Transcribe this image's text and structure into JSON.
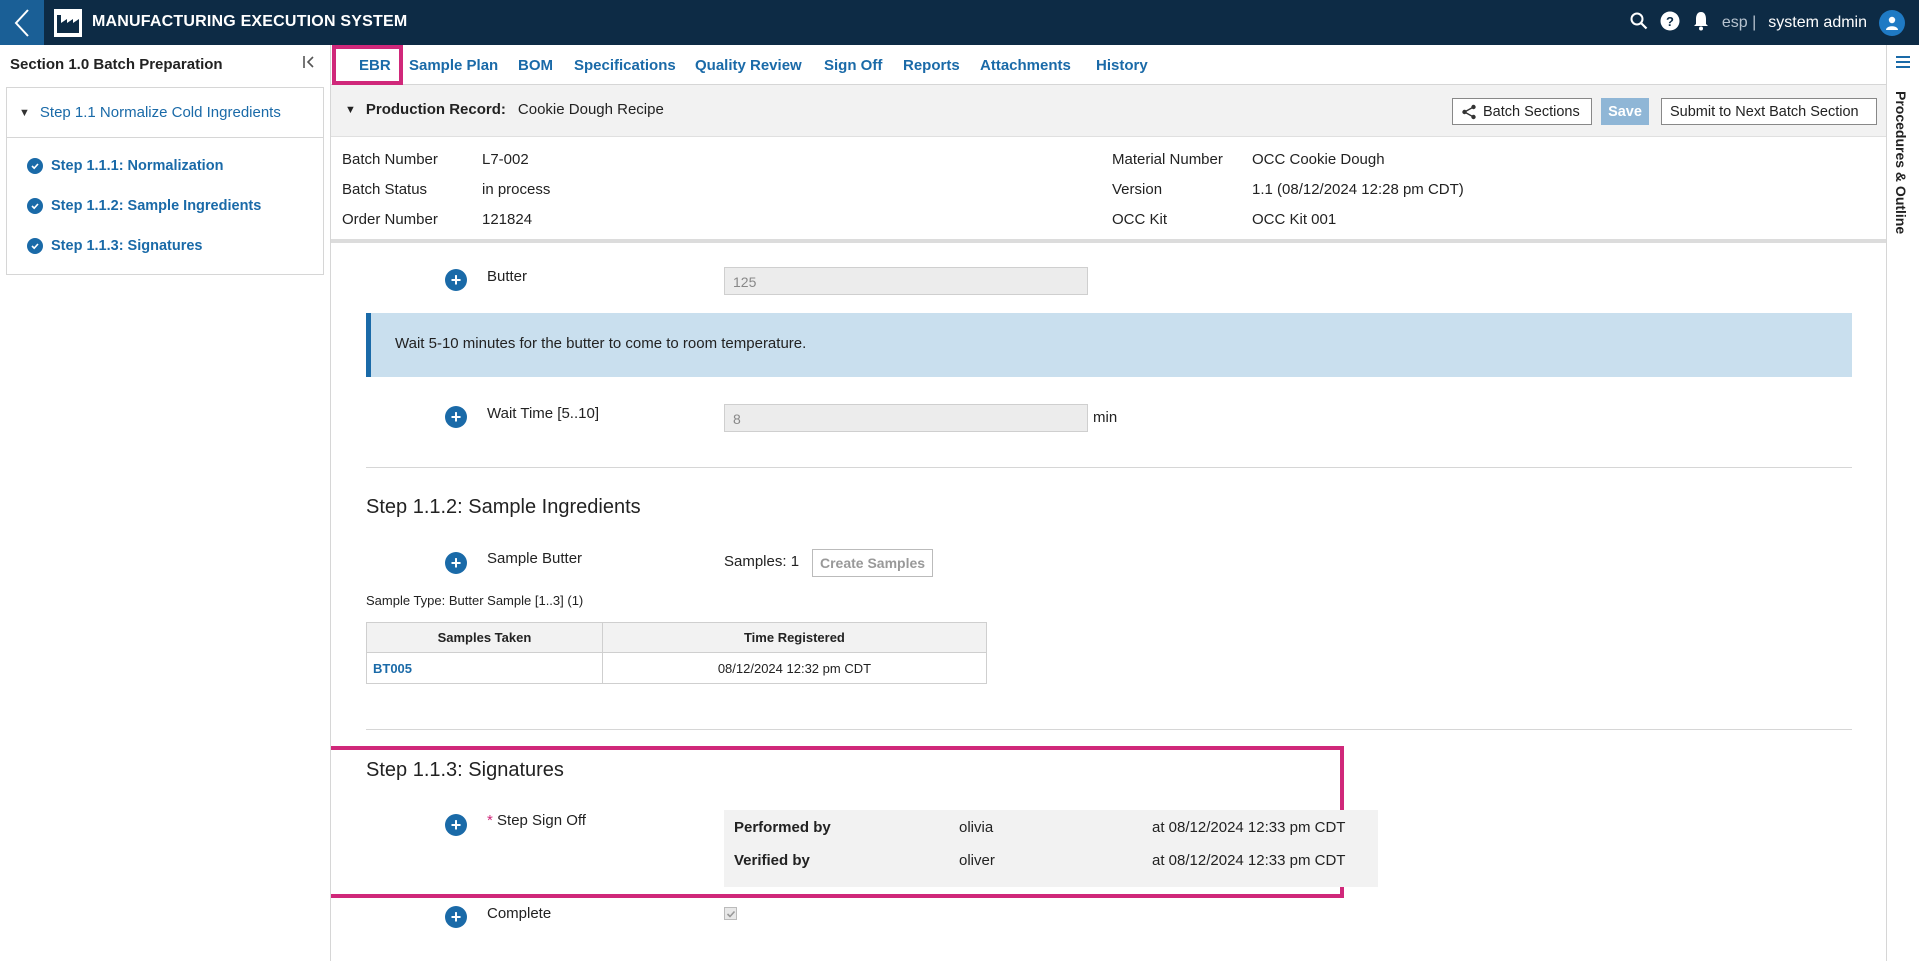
{
  "app": {
    "title": "MANUFACTURING EXECUTION SYSTEM",
    "language": "esp |",
    "user": "system admin"
  },
  "left_panel": {
    "title": "Section 1.0 Batch Preparation",
    "parent_step": "Step 1.1 Normalize Cold Ingredients",
    "steps": [
      "Step 1.1.1: Normalization",
      "Step 1.1.2: Sample Ingredients",
      "Step 1.1.3: Signatures"
    ]
  },
  "tabs": [
    "EBR",
    "Sample Plan",
    "BOM",
    "Specifications",
    "Quality Review",
    "Sign Off",
    "Reports",
    "Attachments",
    "History"
  ],
  "right_rail": {
    "label": "Procedures & Outline"
  },
  "production": {
    "label": "Production Record:",
    "name": "Cookie Dough Recipe",
    "buttons": {
      "batch_sections": "Batch Sections",
      "save": "Save",
      "submit": "Submit to Next Batch Section"
    }
  },
  "info": {
    "batch_number_label": "Batch Number",
    "batch_number": "L7-002",
    "batch_status_label": "Batch Status",
    "batch_status": "in process",
    "order_number_label": "Order Number",
    "order_number": "121824",
    "material_number_label": "Material Number",
    "material_number": "OCC Cookie Dough",
    "version_label": "Version",
    "version": "1.1 (08/12/2024 12:28 pm CDT)",
    "kit_label": "OCC Kit",
    "kit": "OCC Kit 001"
  },
  "fields": {
    "butter_label": "Butter",
    "butter_value": "125",
    "note": "Wait 5-10 minutes for the butter to come to room temperature.",
    "wait_label": "Wait Time [5..10]",
    "wait_value": "8",
    "wait_unit": "min"
  },
  "sample_step": {
    "title": "Step 1.1.2: Sample Ingredients",
    "field_label": "Sample Butter",
    "samples_text": "Samples: 1",
    "create_button": "Create Samples",
    "sample_type": "Sample Type: Butter Sample [1..3] (1)",
    "table": {
      "headers": [
        "Samples Taken",
        "Time Registered"
      ],
      "rows": [
        [
          "BT005",
          "08/12/2024 12:32 pm CDT"
        ]
      ]
    }
  },
  "signature_step": {
    "title": "Step 1.1.3: Signatures",
    "required_mark": "*",
    "field_label": "Step Sign Off",
    "performed_label": "Performed by",
    "performed_by": "olivia",
    "performed_at": "at 08/12/2024 12:33 pm CDT",
    "verified_label": "Verified by",
    "verified_by": "oliver",
    "verified_at": "at 08/12/2024 12:33 pm CDT"
  },
  "complete": {
    "label": "Complete",
    "checked": true
  },
  "colors": {
    "header": "#0d2b45",
    "accent": "#1a6aa8",
    "highlight": "#d0287a",
    "note_bg": "#c9dfee"
  }
}
